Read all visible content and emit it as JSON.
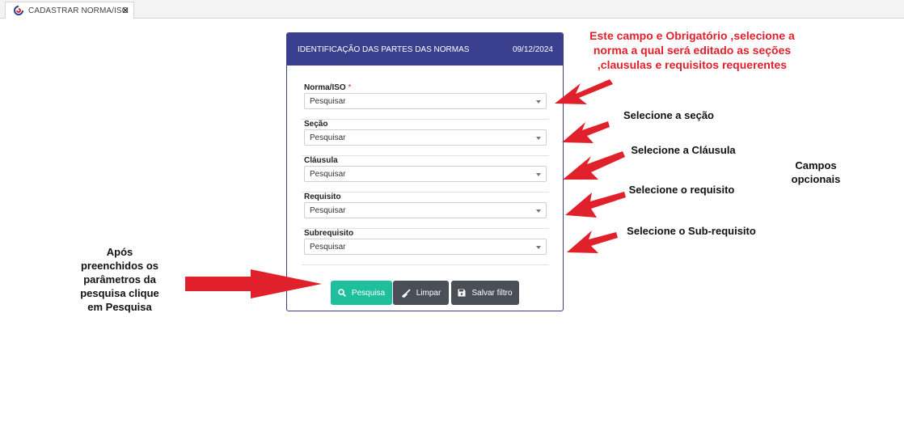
{
  "tab": {
    "title": "CADASTRAR NORMA/ISO",
    "close": "✕"
  },
  "card": {
    "title": "IDENTIFICAÇÃO DAS PARTES DAS NORMAS",
    "date": "09/12/2024",
    "fields": [
      {
        "label": "Norma/ISO",
        "required_mark": "*",
        "value": "Pesquisar"
      },
      {
        "label": "Seção",
        "value": "Pesquisar"
      },
      {
        "label": "Cláusula",
        "value": "Pesquisar"
      },
      {
        "label": "Requisito",
        "value": "Pesquisar"
      },
      {
        "label": "Subrequisito",
        "value": "Pesquisar"
      }
    ],
    "buttons": {
      "search": "Pesquisa",
      "clear": "Limpar",
      "save": "Salvar filtro"
    },
    "colors": {
      "header": "#3a3f8e",
      "search_button": "#1dbf9c",
      "dark_button": "#4a4f57"
    }
  },
  "annotations": {
    "required": "Este campo e Obrigatório ,selecione a norma a qual será editado as seções ,clausulas e requisitos requerentes",
    "section": "Selecione a seção",
    "clause": "Selecione a Cláusula",
    "requirement": "Selecione o requisito",
    "subrequirement": "Selecione o Sub-requisito",
    "optional": "Campos opcionais",
    "search_hint": "Após preenchidos os parâmetros da pesquisa clique em Pesquisa",
    "color": "#e0202a"
  }
}
